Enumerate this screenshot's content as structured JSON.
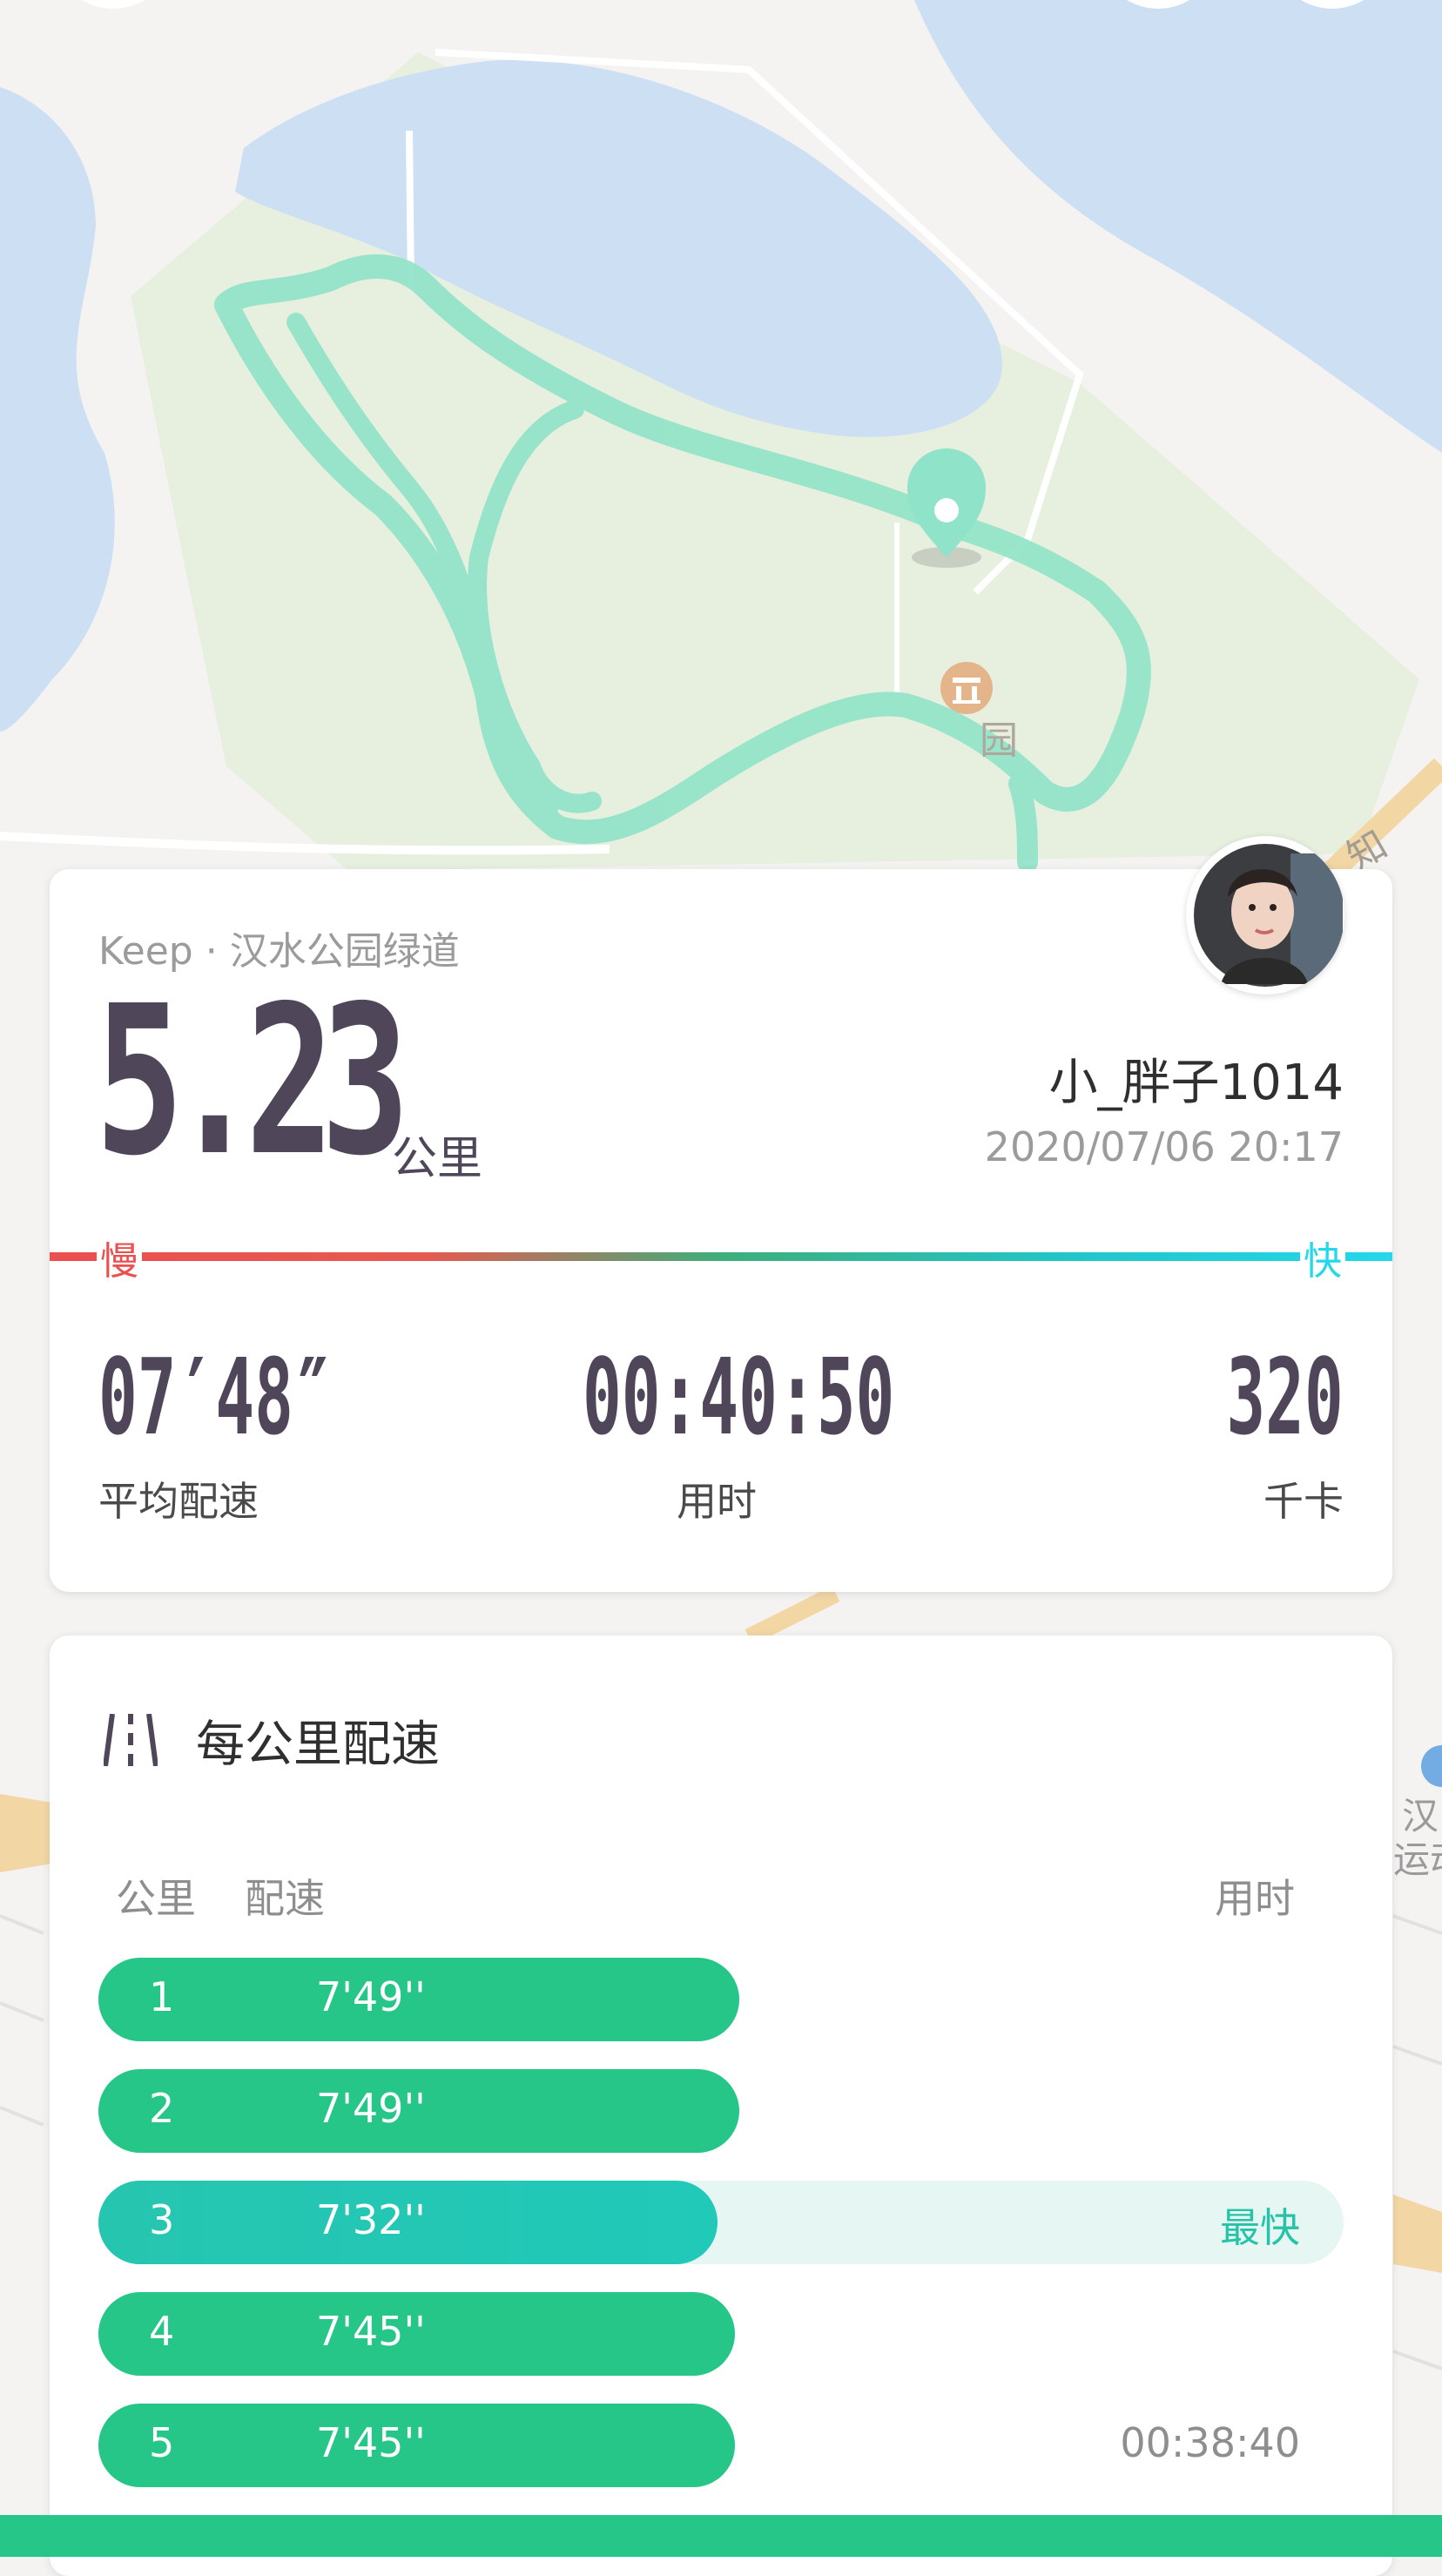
{
  "map": {
    "poi_label": "园",
    "road_label": "知",
    "side_label_1": "汉",
    "side_label_2": "运动"
  },
  "summary": {
    "source": "Keep · 汉水公园绿道",
    "distance": "5.23",
    "distance_unit": "公里",
    "username": "小_胖子1014",
    "datetime": "2020/07/06 20:17",
    "slow_label": "慢",
    "fast_label": "快",
    "stats": [
      {
        "value": "07′48″",
        "label": "平均配速"
      },
      {
        "value": "00:40:50",
        "label": "用时"
      },
      {
        "value": "320",
        "label": "千卡"
      }
    ]
  },
  "splits": {
    "title": "每公里配速",
    "columns": {
      "km": "公里",
      "pace": "配速",
      "time": "用时"
    },
    "rows": [
      {
        "km": "1",
        "pace": "7'49''",
        "fill_ratio": 0.515
      },
      {
        "km": "2",
        "pace": "7'49''",
        "fill_ratio": 0.515
      },
      {
        "km": "3",
        "pace": "7'32''",
        "fill_ratio": 0.497,
        "tag": "最快"
      },
      {
        "km": "4",
        "pace": "7'45''",
        "fill_ratio": 0.511
      },
      {
        "km": "5",
        "pace": "7'45''",
        "fill_ratio": 0.511,
        "time": "00:38:40"
      }
    ]
  },
  "colors": {
    "accent": "#26c588",
    "fastest": "#27c3a8",
    "slow": "#eb4f4f",
    "fast": "#23d8ea",
    "route": "#8fe3c8"
  }
}
